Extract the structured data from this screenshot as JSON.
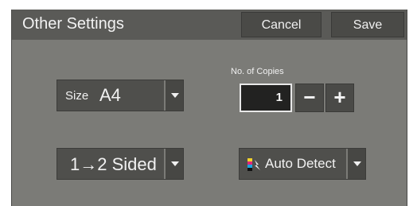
{
  "header": {
    "title": "Other Settings",
    "cancel_label": "Cancel",
    "save_label": "Save"
  },
  "size": {
    "label": "Size",
    "value": "A4"
  },
  "copies": {
    "label": "No. of Copies",
    "value": "1",
    "minus_label": "−",
    "plus_label": "+"
  },
  "sides": {
    "value": "1→2 Sided"
  },
  "color_mode": {
    "value": "Auto Detect",
    "icon": "color-mode-icon"
  },
  "colors": {
    "panel_bg": "#7b7b77",
    "header_bg": "#5a5a57",
    "button_bg": "#4a4a47"
  }
}
